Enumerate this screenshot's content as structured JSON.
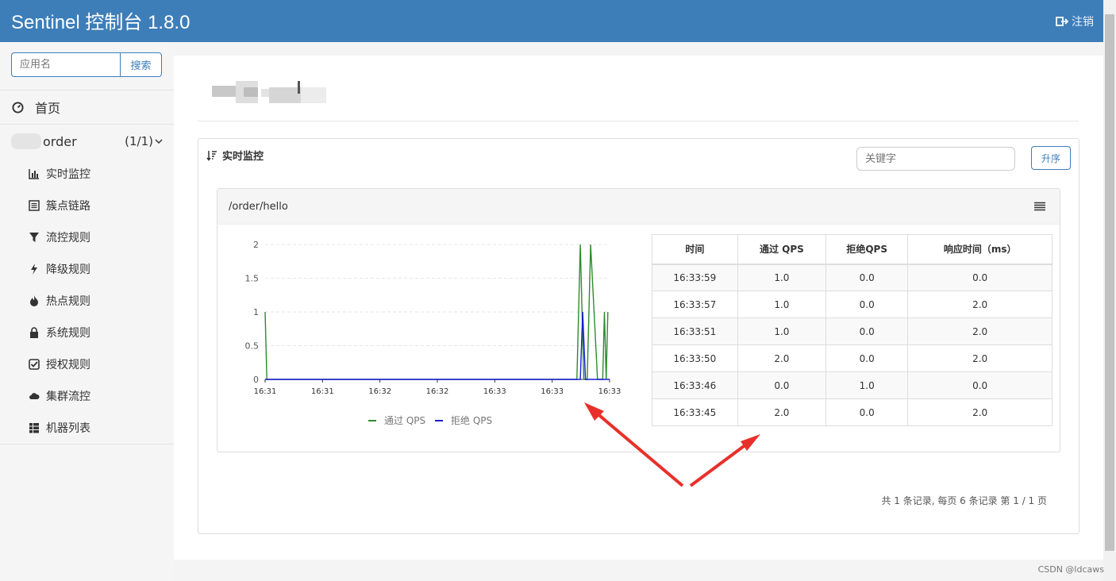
{
  "header": {
    "title": "Sentinel 控制台 1.8.0",
    "logout": "注销"
  },
  "sidebar": {
    "search_placeholder": "应用名",
    "search_button": "搜索",
    "home": "首页",
    "app": {
      "name_suffix": "order",
      "count": "(1/1)"
    },
    "items": [
      {
        "label": "实时监控",
        "icon": "bar-chart-icon"
      },
      {
        "label": "簇点链路",
        "icon": "list-icon"
      },
      {
        "label": "流控规则",
        "icon": "filter-icon"
      },
      {
        "label": "降级规则",
        "icon": "flash-icon"
      },
      {
        "label": "热点规则",
        "icon": "fire-icon"
      },
      {
        "label": "系统规则",
        "icon": "lock-icon"
      },
      {
        "label": "授权规则",
        "icon": "check-icon"
      },
      {
        "label": "集群流控",
        "icon": "cloud-icon"
      },
      {
        "label": "机器列表",
        "icon": "th-list-icon"
      }
    ]
  },
  "panel": {
    "title": "实时监控",
    "keyword_placeholder": "关键字",
    "sort_button": "升序",
    "resource": "/order/hello",
    "pager": "共 1 条记录, 每页 6 条记录 第 1 / 1 页"
  },
  "chart_data": {
    "type": "line",
    "x": [
      "16:31",
      "16:31",
      "16:32",
      "16:32",
      "16:33",
      "16:33",
      "16:33"
    ],
    "ylim": [
      0,
      2
    ],
    "yticks": [
      "2",
      "1.5",
      "1",
      "0.5",
      "0"
    ],
    "grid": true,
    "legend_position": "bottom",
    "series": [
      {
        "name": "通过 QPS",
        "color": "#2e8b2e",
        "values": [
          [
            0,
            1
          ],
          [
            0.005,
            0
          ],
          [
            0.905,
            0
          ],
          [
            0.915,
            2
          ],
          [
            0.925,
            0
          ],
          [
            0.935,
            0
          ],
          [
            0.945,
            2
          ],
          [
            0.965,
            0
          ],
          [
            0.98,
            0
          ],
          [
            0.985,
            1
          ],
          [
            0.99,
            0
          ],
          [
            0.995,
            1
          ]
        ]
      },
      {
        "name": "拒绝 QPS",
        "color": "#1a1ad6",
        "values": [
          [
            0,
            0
          ],
          [
            0.915,
            0
          ],
          [
            0.922,
            1
          ],
          [
            0.93,
            0
          ],
          [
            1,
            0
          ]
        ]
      }
    ]
  },
  "table": {
    "headers": [
      "时间",
      "通过 QPS",
      "拒绝QPS",
      "响应时间（ms）"
    ],
    "rows": [
      [
        "16:33:59",
        "1.0",
        "0.0",
        "0.0"
      ],
      [
        "16:33:57",
        "1.0",
        "0.0",
        "2.0"
      ],
      [
        "16:33:51",
        "1.0",
        "0.0",
        "2.0"
      ],
      [
        "16:33:50",
        "2.0",
        "0.0",
        "2.0"
      ],
      [
        "16:33:46",
        "0.0",
        "1.0",
        "0.0"
      ],
      [
        "16:33:45",
        "2.0",
        "0.0",
        "2.0"
      ]
    ]
  },
  "footer": {
    "credit": "CSDN @ldcaws"
  }
}
